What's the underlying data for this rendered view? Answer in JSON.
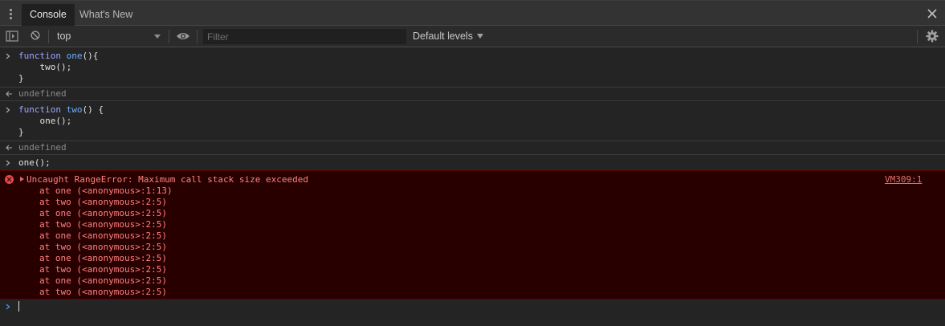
{
  "tabs": [
    {
      "label": "Console",
      "active": true
    },
    {
      "label": "What's New",
      "active": false
    }
  ],
  "toolbar": {
    "context": "top",
    "filter_placeholder": "Filter",
    "filter_value": "",
    "levels": "Default levels"
  },
  "entries": [
    {
      "type": "input",
      "lines": [
        {
          "kw": "function",
          "fn": "one",
          "rest": "(){"
        },
        {
          "text": "    two();"
        },
        {
          "text": "}"
        }
      ]
    },
    {
      "type": "result",
      "text": "undefined"
    },
    {
      "type": "input",
      "lines": [
        {
          "kw": "function",
          "fn": "two",
          "rest": "() {"
        },
        {
          "text": "    one();"
        },
        {
          "text": "}"
        }
      ]
    },
    {
      "type": "result",
      "text": "undefined"
    },
    {
      "type": "input",
      "lines": [
        {
          "text": "one();"
        }
      ]
    }
  ],
  "error": {
    "message": "Uncaught RangeError: Maximum call stack size exceeded",
    "source": "VM309:1",
    "stack": [
      "at one (<anonymous>:1:13)",
      "at two (<anonymous>:2:5)",
      "at one (<anonymous>:2:5)",
      "at two (<anonymous>:2:5)",
      "at one (<anonymous>:2:5)",
      "at two (<anonymous>:2:5)",
      "at one (<anonymous>:2:5)",
      "at two (<anonymous>:2:5)",
      "at one (<anonymous>:2:5)",
      "at two (<anonymous>:2:5)"
    ]
  },
  "colors": {
    "background": "#242424",
    "error_background": "#290000",
    "error_text": "#ff8080",
    "keyword": "#9aa7ff",
    "function_name": "#6fb0ff"
  }
}
